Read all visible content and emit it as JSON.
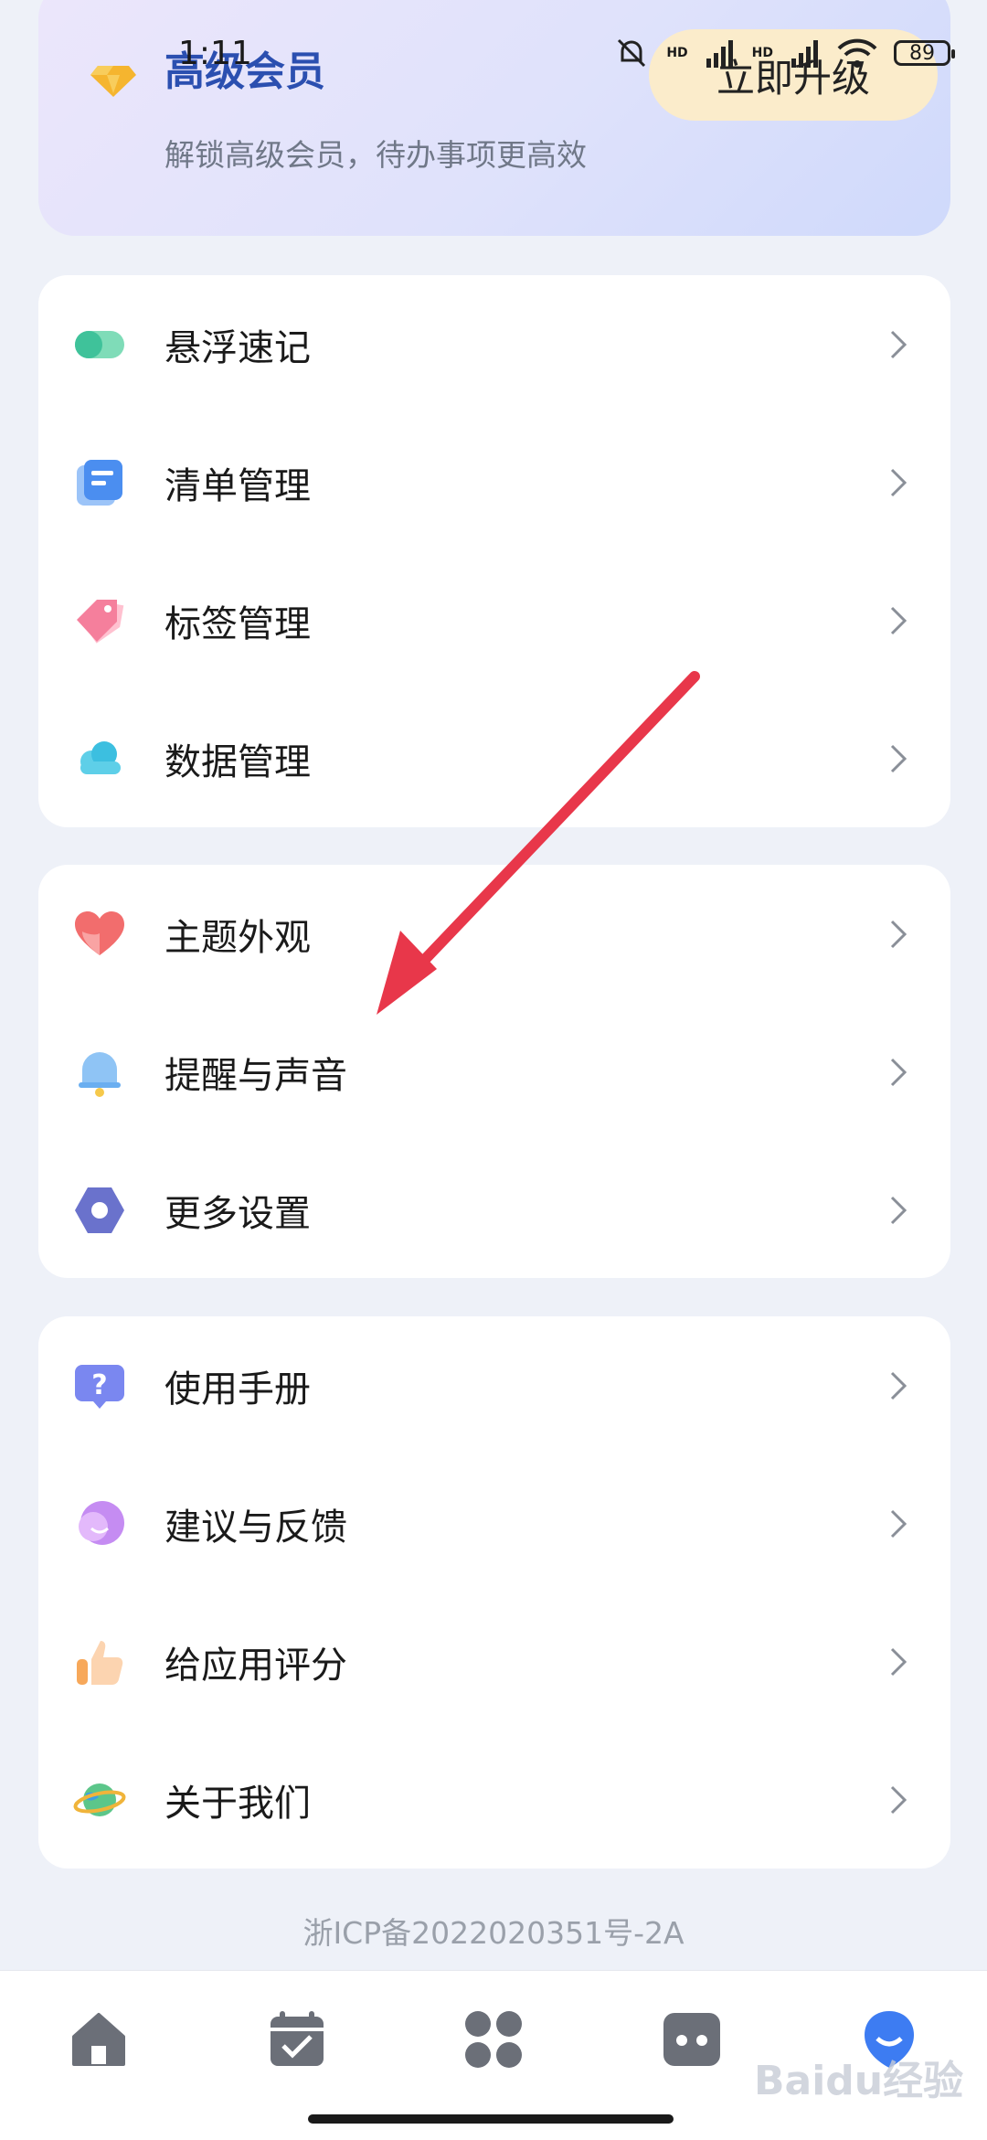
{
  "status_bar": {
    "time": "1:11",
    "network_1": "HD",
    "network_2": "HD",
    "battery": "89"
  },
  "vip": {
    "title": "高级会员",
    "subtitle": "解锁高级会员，待办事项更高效",
    "upgrade_label": "立即升级"
  },
  "group1": [
    {
      "label": "悬浮速记",
      "icon": "floating-note-icon"
    },
    {
      "label": "清单管理",
      "icon": "list-icon"
    },
    {
      "label": "标签管理",
      "icon": "tag-icon"
    },
    {
      "label": "数据管理",
      "icon": "cloud-icon"
    }
  ],
  "group2": [
    {
      "label": "主题外观",
      "icon": "heart-icon"
    },
    {
      "label": "提醒与声音",
      "icon": "bell-icon"
    },
    {
      "label": "更多设置",
      "icon": "hexagon-gear-icon"
    }
  ],
  "group3": [
    {
      "label": "使用手册",
      "icon": "question-bubble-icon"
    },
    {
      "label": "建议与反馈",
      "icon": "chat-bubble-icon"
    },
    {
      "label": "给应用评分",
      "icon": "thumbs-up-icon"
    },
    {
      "label": "关于我们",
      "icon": "planet-icon"
    }
  ],
  "icp": "浙ICP备2022020351号-2A",
  "nav": [
    {
      "icon": "home-icon",
      "active": false
    },
    {
      "icon": "calendar-check-icon",
      "active": false
    },
    {
      "icon": "apps-grid-icon",
      "active": false
    },
    {
      "icon": "robot-icon",
      "active": false
    },
    {
      "icon": "profile-icon",
      "active": true
    }
  ],
  "colors": {
    "accent": "#2b4fb0",
    "upgrade_bg": "#fbeccb",
    "annotation_arrow": "#e8374a",
    "nav_inactive": "#6b6f78",
    "nav_active": "#3d7cf2"
  },
  "watermark": "Baidu经验"
}
